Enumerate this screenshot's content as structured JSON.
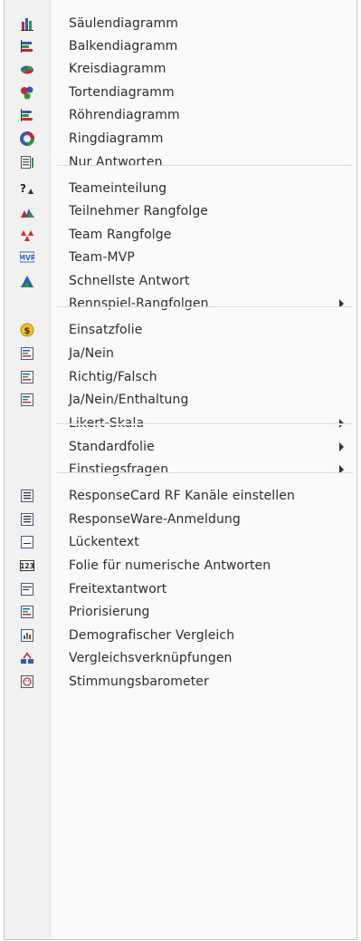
{
  "menu": {
    "items": [
      {
        "label": "Säulendiagramm",
        "icon": "column-chart-icon"
      },
      {
        "label": "Balkendiagramm",
        "icon": "bar-chart-icon"
      },
      {
        "label": "Kreisdiagramm",
        "icon": "pie-chart-icon"
      },
      {
        "label": "Tortendiagramm",
        "icon": "exploded-pie-icon"
      },
      {
        "label": "Röhrendiagramm",
        "icon": "cylinder-chart-icon"
      },
      {
        "label": "Ringdiagramm",
        "icon": "donut-chart-icon"
      },
      {
        "label": "Nur Antworten",
        "icon": "answers-only-icon"
      },
      {
        "label": "Teameinteilung",
        "icon": "team-assignment-icon"
      },
      {
        "label": "Teilnehmer Rangfolge",
        "icon": "participant-ranking-icon"
      },
      {
        "label": "Team Rangfolge",
        "icon": "team-ranking-icon"
      },
      {
        "label": "Team-MVP",
        "icon": "mvp-icon",
        "icon_text": "MVP"
      },
      {
        "label": "Schnellste Antwort",
        "icon": "fastest-answer-icon"
      },
      {
        "label": "Rennspiel-Rangfolgen",
        "icon": "",
        "submenu": true
      },
      {
        "label": "Einsatzfolie",
        "icon": "wager-coin-icon",
        "icon_text": "$"
      },
      {
        "label": "Ja/Nein",
        "icon": "yes-no-slide-icon"
      },
      {
        "label": "Richtig/Falsch",
        "icon": "true-false-slide-icon"
      },
      {
        "label": "Ja/Nein/Enthaltung",
        "icon": "yes-no-abstain-slide-icon"
      },
      {
        "label": "Likert-Skala",
        "icon": "",
        "submenu": true
      },
      {
        "label": "Standardfolie",
        "icon": "",
        "submenu": true
      },
      {
        "label": "Einstiegsfragen",
        "icon": "",
        "submenu": true
      },
      {
        "label": "ResponseCard RF Kanäle einstellen",
        "icon": "channel-slide-icon"
      },
      {
        "label": "ResponseWare-Anmeldung",
        "icon": "responseware-slide-icon"
      },
      {
        "label": "Lückentext",
        "icon": "fill-in-blank-icon"
      },
      {
        "label": "Folie für numerische Antworten",
        "icon": "numeric-response-icon",
        "icon_text": "123"
      },
      {
        "label": "Freitextantwort",
        "icon": "free-text-icon"
      },
      {
        "label": "Priorisierung",
        "icon": "prioritization-icon"
      },
      {
        "label": "Demografischer Vergleich",
        "icon": "demographic-comparison-icon"
      },
      {
        "label": "Vergleichsverknüpfungen",
        "icon": "comparison-links-icon"
      },
      {
        "label": "Stimmungsbarometer",
        "icon": "mood-meter-icon"
      }
    ]
  }
}
